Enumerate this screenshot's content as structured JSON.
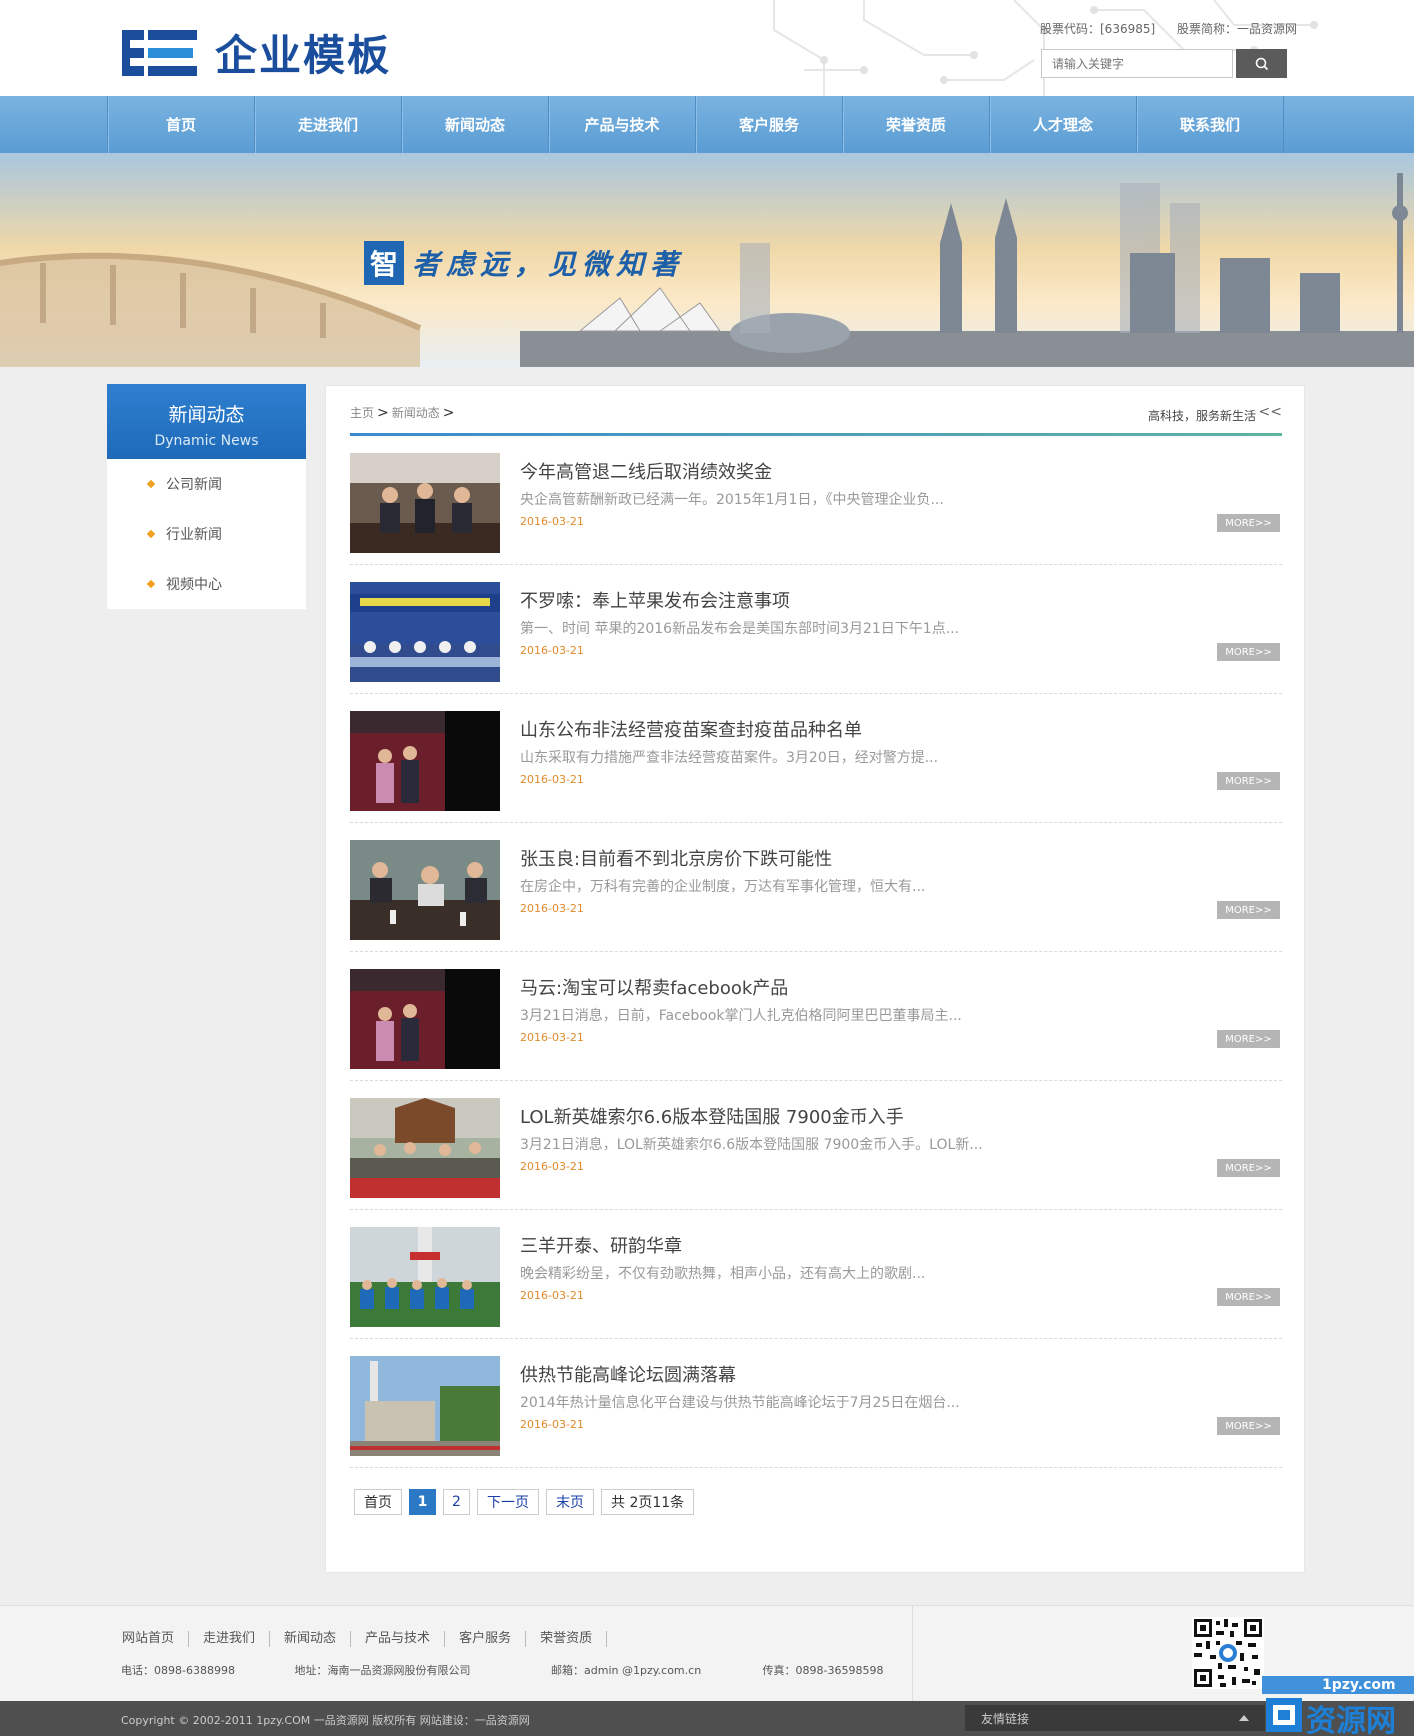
{
  "header": {
    "logo_text": "企业模板",
    "stock_code": "股票代码：[636985]",
    "stock_name": "股票简称：一品资源网",
    "search_placeholder": "请输入关键字"
  },
  "nav": {
    "items": [
      "首页",
      "走进我们",
      "新闻动态",
      "产品与技术",
      "客户服务",
      "荣誉资质",
      "人才理念",
      "联系我们"
    ]
  },
  "banner": {
    "slogan_first": "智",
    "slogan_rest": "者虑远，见微知著"
  },
  "sidebar": {
    "title": "新闻动态",
    "subtitle": "Dynamic News",
    "items": [
      "公司新闻",
      "行业新闻",
      "视频中心"
    ]
  },
  "content": {
    "breadcrumb_home": "主页",
    "breadcrumb_sep": ">",
    "breadcrumb_current": "新闻动态",
    "slogan": "高科技，服务新生活",
    "arrows": "<<",
    "more_label": "MORE>>",
    "news": [
      {
        "title": "今年高管退二线后取消绩效奖金",
        "summary": "央企高管薪酬新政已经满一年。2015年1月1日，《中央管理企业负...",
        "date": "2016-03-21"
      },
      {
        "title": "不罗嗦：奉上苹果发布会注意事项",
        "summary": "第一、时间 苹果的2016新品发布会是美国东部时间3月21日下午1点...",
        "date": "2016-03-21"
      },
      {
        "title": "山东公布非法经营疫苗案查封疫苗品种名单",
        "summary": "山东采取有力措施严查非法经营疫苗案件。3月20日，经对警方提...",
        "date": "2016-03-21"
      },
      {
        "title": "张玉良:目前看不到北京房价下跌可能性",
        "summary": "在房企中，万科有完善的企业制度，万达有军事化管理，恒大有...",
        "date": "2016-03-21"
      },
      {
        "title": "马云:淘宝可以帮卖facebook产品",
        "summary": "3月21日消息，日前，Facebook掌门人扎克伯格同阿里巴巴董事局主...",
        "date": "2016-03-21"
      },
      {
        "title": "LOL新英雄索尔6.6版本登陆国服 7900金币入手",
        "summary": "3月21日消息，LOL新英雄索尔6.6版本登陆国服 7900金币入手。LOL新...",
        "date": "2016-03-21"
      },
      {
        "title": "三羊开泰、研韵华章",
        "summary": "晚会精彩纷呈，不仅有劲歌热舞，相声小品，还有高大上的歌剧...",
        "date": "2016-03-21"
      },
      {
        "title": "供热节能高峰论坛圆满落幕",
        "summary": "2014年热计量信息化平台建设与供热节能高峰论坛于7月25日在烟台...",
        "date": "2016-03-21"
      }
    ],
    "pager": {
      "first": "首页",
      "p1": "1",
      "p2": "2",
      "next": "下一页",
      "last": "末页",
      "total": "共 2页11条"
    }
  },
  "footer": {
    "links": [
      "网站首页",
      "走进我们",
      "新闻动态",
      "产品与技术",
      "客户服务",
      "荣誉资质"
    ],
    "phone": "电话：0898-6388998",
    "address": "地址：海南一品资源网股份有限公司",
    "email": "邮箱：admin @1pzy.com.cn",
    "fax": "传真：0898-36598598",
    "copyright": "Copyright © 2002-2011 1pzy.COM 一品资源网 版权所有  网站建设：一品资源网",
    "friend_links": "友情链接"
  },
  "watermark": {
    "domain": "1pzy.com",
    "text": "资源网"
  }
}
